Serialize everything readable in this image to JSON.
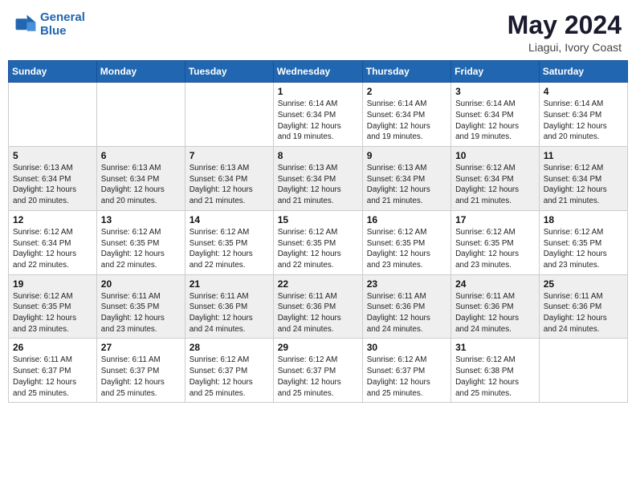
{
  "header": {
    "logo_line1": "General",
    "logo_line2": "Blue",
    "main_title": "May 2024",
    "subtitle": "Liagui, Ivory Coast"
  },
  "days_of_week": [
    "Sunday",
    "Monday",
    "Tuesday",
    "Wednesday",
    "Thursday",
    "Friday",
    "Saturday"
  ],
  "weeks": [
    [
      {
        "day": "",
        "info": ""
      },
      {
        "day": "",
        "info": ""
      },
      {
        "day": "",
        "info": ""
      },
      {
        "day": "1",
        "info": "Sunrise: 6:14 AM\nSunset: 6:34 PM\nDaylight: 12 hours\nand 19 minutes."
      },
      {
        "day": "2",
        "info": "Sunrise: 6:14 AM\nSunset: 6:34 PM\nDaylight: 12 hours\nand 19 minutes."
      },
      {
        "day": "3",
        "info": "Sunrise: 6:14 AM\nSunset: 6:34 PM\nDaylight: 12 hours\nand 19 minutes."
      },
      {
        "day": "4",
        "info": "Sunrise: 6:14 AM\nSunset: 6:34 PM\nDaylight: 12 hours\nand 20 minutes."
      }
    ],
    [
      {
        "day": "5",
        "info": "Sunrise: 6:13 AM\nSunset: 6:34 PM\nDaylight: 12 hours\nand 20 minutes."
      },
      {
        "day": "6",
        "info": "Sunrise: 6:13 AM\nSunset: 6:34 PM\nDaylight: 12 hours\nand 20 minutes."
      },
      {
        "day": "7",
        "info": "Sunrise: 6:13 AM\nSunset: 6:34 PM\nDaylight: 12 hours\nand 21 minutes."
      },
      {
        "day": "8",
        "info": "Sunrise: 6:13 AM\nSunset: 6:34 PM\nDaylight: 12 hours\nand 21 minutes."
      },
      {
        "day": "9",
        "info": "Sunrise: 6:13 AM\nSunset: 6:34 PM\nDaylight: 12 hours\nand 21 minutes."
      },
      {
        "day": "10",
        "info": "Sunrise: 6:12 AM\nSunset: 6:34 PM\nDaylight: 12 hours\nand 21 minutes."
      },
      {
        "day": "11",
        "info": "Sunrise: 6:12 AM\nSunset: 6:34 PM\nDaylight: 12 hours\nand 21 minutes."
      }
    ],
    [
      {
        "day": "12",
        "info": "Sunrise: 6:12 AM\nSunset: 6:34 PM\nDaylight: 12 hours\nand 22 minutes."
      },
      {
        "day": "13",
        "info": "Sunrise: 6:12 AM\nSunset: 6:35 PM\nDaylight: 12 hours\nand 22 minutes."
      },
      {
        "day": "14",
        "info": "Sunrise: 6:12 AM\nSunset: 6:35 PM\nDaylight: 12 hours\nand 22 minutes."
      },
      {
        "day": "15",
        "info": "Sunrise: 6:12 AM\nSunset: 6:35 PM\nDaylight: 12 hours\nand 22 minutes."
      },
      {
        "day": "16",
        "info": "Sunrise: 6:12 AM\nSunset: 6:35 PM\nDaylight: 12 hours\nand 23 minutes."
      },
      {
        "day": "17",
        "info": "Sunrise: 6:12 AM\nSunset: 6:35 PM\nDaylight: 12 hours\nand 23 minutes."
      },
      {
        "day": "18",
        "info": "Sunrise: 6:12 AM\nSunset: 6:35 PM\nDaylight: 12 hours\nand 23 minutes."
      }
    ],
    [
      {
        "day": "19",
        "info": "Sunrise: 6:12 AM\nSunset: 6:35 PM\nDaylight: 12 hours\nand 23 minutes."
      },
      {
        "day": "20",
        "info": "Sunrise: 6:11 AM\nSunset: 6:35 PM\nDaylight: 12 hours\nand 23 minutes."
      },
      {
        "day": "21",
        "info": "Sunrise: 6:11 AM\nSunset: 6:36 PM\nDaylight: 12 hours\nand 24 minutes."
      },
      {
        "day": "22",
        "info": "Sunrise: 6:11 AM\nSunset: 6:36 PM\nDaylight: 12 hours\nand 24 minutes."
      },
      {
        "day": "23",
        "info": "Sunrise: 6:11 AM\nSunset: 6:36 PM\nDaylight: 12 hours\nand 24 minutes."
      },
      {
        "day": "24",
        "info": "Sunrise: 6:11 AM\nSunset: 6:36 PM\nDaylight: 12 hours\nand 24 minutes."
      },
      {
        "day": "25",
        "info": "Sunrise: 6:11 AM\nSunset: 6:36 PM\nDaylight: 12 hours\nand 24 minutes."
      }
    ],
    [
      {
        "day": "26",
        "info": "Sunrise: 6:11 AM\nSunset: 6:37 PM\nDaylight: 12 hours\nand 25 minutes."
      },
      {
        "day": "27",
        "info": "Sunrise: 6:11 AM\nSunset: 6:37 PM\nDaylight: 12 hours\nand 25 minutes."
      },
      {
        "day": "28",
        "info": "Sunrise: 6:12 AM\nSunset: 6:37 PM\nDaylight: 12 hours\nand 25 minutes."
      },
      {
        "day": "29",
        "info": "Sunrise: 6:12 AM\nSunset: 6:37 PM\nDaylight: 12 hours\nand 25 minutes."
      },
      {
        "day": "30",
        "info": "Sunrise: 6:12 AM\nSunset: 6:37 PM\nDaylight: 12 hours\nand 25 minutes."
      },
      {
        "day": "31",
        "info": "Sunrise: 6:12 AM\nSunset: 6:38 PM\nDaylight: 12 hours\nand 25 minutes."
      },
      {
        "day": "",
        "info": ""
      }
    ]
  ]
}
